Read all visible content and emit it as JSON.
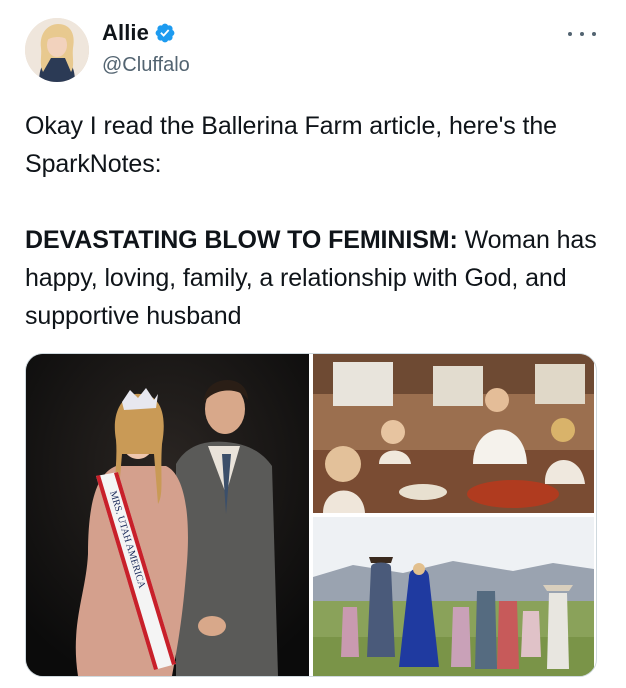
{
  "author": {
    "display_name": "Allie",
    "handle": "@Cluffalo",
    "verified": true,
    "avatar_icon": "profile-photo"
  },
  "menu": {
    "icon": "more-horizontal-icon"
  },
  "tweet": {
    "line1": "Okay I read the Ballerina Farm article, here's the SparkNotes:",
    "headline_bold": "DEVASTATING BLOW TO FEMINISM:",
    "headline_rest": " Woman has happy, loving, family, a relationship with God, and supportive husband"
  },
  "media": {
    "sash_text": "MRS. UTAH AMERICA"
  },
  "colors": {
    "verified": "#1d9bf0",
    "secondary_text": "#536471",
    "border": "#cfd9de"
  }
}
